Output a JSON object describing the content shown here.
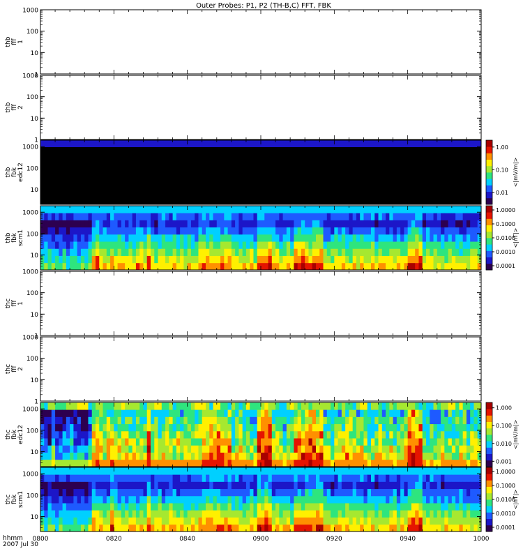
{
  "title": "Outer Probes: P1, P2 (TH-B,C) FFT, FBK",
  "footer": {
    "time_label": "hhmm",
    "date_label": "2007 Jul 30"
  },
  "x_axis": {
    "ticks": [
      "0800",
      "0820",
      "0840",
      "0900",
      "0920",
      "0940",
      "1000"
    ]
  },
  "colormap": [
    "#2d0050",
    "#1c16c8",
    "#1e5aff",
    "#00d0ff",
    "#2ee57e",
    "#a6e830",
    "#fff000",
    "#ff9000",
    "#e51400",
    "#a80000"
  ],
  "chart_data": [
    {
      "type": "heatmap",
      "id": "thb-fff1",
      "ylabel": [
        "thb",
        "fff",
        "1"
      ],
      "yticks": [
        "1",
        "10",
        "100",
        "1000"
      ],
      "ylim": [
        1,
        1000
      ],
      "y_scale": "log",
      "empty": true
    },
    {
      "type": "heatmap",
      "id": "thb-fff2",
      "ylabel": [
        "thb",
        "fff",
        "2"
      ],
      "yticks": [
        "1",
        "10",
        "100",
        "1000"
      ],
      "ylim": [
        1,
        1000
      ],
      "y_scale": "log",
      "empty": true
    },
    {
      "type": "heatmap",
      "id": "thb-fbk-edc12",
      "ylabel": [
        "thb",
        "fbk",
        "edc12"
      ],
      "yticks": [
        "10",
        "100",
        "1000"
      ],
      "ylim": [
        2,
        2000
      ],
      "y_scale": "log",
      "pattern": "solid-black",
      "colorbar": {
        "label": "<|mV/m|>",
        "ticks": [
          "0.01",
          "0.10",
          "1.00"
        ],
        "range": [
          0.003,
          2.0
        ]
      }
    },
    {
      "type": "heatmap",
      "id": "thb-fbk-scm1",
      "ylabel": [
        "thb",
        "fbk",
        "scm1"
      ],
      "yticks": [
        "10",
        "100",
        "1000"
      ],
      "ylim": [
        2,
        2000
      ],
      "y_scale": "log",
      "pattern": "scm",
      "colorbar": {
        "label": "<|nT|>",
        "ticks": [
          "0.0001",
          "0.0010",
          "0.0100",
          "0.1000",
          "1.0000"
        ],
        "range": [
          5e-05,
          2.0
        ]
      }
    },
    {
      "type": "heatmap",
      "id": "thc-fff1",
      "ylabel": [
        "thc",
        "fff",
        "1"
      ],
      "yticks": [
        "1",
        "10",
        "100",
        "1000"
      ],
      "ylim": [
        1,
        1000
      ],
      "y_scale": "log",
      "empty": true
    },
    {
      "type": "heatmap",
      "id": "thc-fff2",
      "ylabel": [
        "thc",
        "fff",
        "2"
      ],
      "yticks": [
        "1",
        "10",
        "100",
        "1000"
      ],
      "ylim": [
        1,
        1000
      ],
      "y_scale": "log",
      "empty": true
    },
    {
      "type": "heatmap",
      "id": "thc-fbk-edc12",
      "ylabel": [
        "thc",
        "fbk",
        "edc12"
      ],
      "yticks": [
        "10",
        "100",
        "1000"
      ],
      "ylim": [
        2,
        2000
      ],
      "y_scale": "log",
      "pattern": "edc",
      "colorbar": {
        "label": "<|mV/m|>",
        "ticks": [
          "0.001",
          "0.010",
          "0.100",
          "1.000"
        ],
        "range": [
          0.0005,
          2.0
        ]
      }
    },
    {
      "type": "heatmap",
      "id": "thc-fbk-scm1",
      "ylabel": [
        "thc",
        "fbk",
        "scm1"
      ],
      "yticks": [
        "10",
        "100",
        "1000"
      ],
      "ylim": [
        2,
        2000
      ],
      "y_scale": "log",
      "pattern": "scm",
      "colorbar": {
        "label": "<|nT|>",
        "ticks": [
          "0.0001",
          "0.0010",
          "0.0100",
          "0.1000",
          "1.0000"
        ],
        "range": [
          5e-05,
          2.0
        ]
      }
    }
  ]
}
